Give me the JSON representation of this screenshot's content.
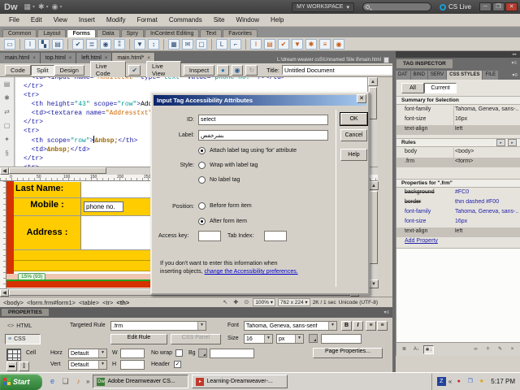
{
  "colors": {
    "form_yellow": "#FFCC00",
    "page_red": "#D63100",
    "dialog_title_start": "#0A246A",
    "dialog_title_end": "#A6CAF0",
    "link_blue": "#0000CC",
    "css_value_blue": "#2222AA"
  },
  "titlebar": {
    "logo": "Dw",
    "workspace_label": "MY WORKSPACE",
    "cs_live_label": "CS Live"
  },
  "menubar": {
    "items": [
      "File",
      "Edit",
      "View",
      "Insert",
      "Modify",
      "Format",
      "Commands",
      "Site",
      "Window",
      "Help"
    ]
  },
  "insert_bar": {
    "tabs": [
      "Common",
      "Layout",
      "Forms",
      "Data",
      "Spry",
      "InContext Editing",
      "Text",
      "Favorites"
    ],
    "active_tab": "Forms",
    "icons": [
      "form",
      "text-field",
      "hidden-field",
      "textarea",
      "checkbox",
      "checkbox-group",
      "radio-button",
      "radio-group",
      "select-list",
      "jump-menu",
      "image-field",
      "file-field",
      "button",
      "label",
      "fieldset",
      "spry-text-field",
      "spry-textarea",
      "spry-checkbox",
      "spry-select",
      "spry-password",
      "spry-confirm",
      "spry-radio-group"
    ]
  },
  "doc_tabs": {
    "tabs": [
      {
        "label": "main.html",
        "active": false
      },
      {
        "label": "top.html",
        "active": false
      },
      {
        "label": "left.html",
        "active": false
      },
      {
        "label": "main.html*",
        "active": true
      }
    ],
    "path": "L:\\dream weaver cs5\\Unnamed Site 8\\main.html"
  },
  "doc_toolbar": {
    "view_buttons": [
      "Code",
      "Split",
      "Design"
    ],
    "active_view": "Split",
    "live_code": "Live Code",
    "live_view": "Live View",
    "inspect": "Inspect",
    "title_label": "Title:",
    "title_value": "Untitled Document"
  },
  "code_view": {
    "lines": [
      {
        "seg": [
          {
            "t": "  <td><input name=",
            "c": "t"
          },
          {
            "t": "\"Mobiletxt\"",
            "c": "s"
          },
          {
            "t": " type=",
            "c": "t"
          },
          {
            "t": "\"text\"",
            "c": "v"
          },
          {
            "t": " value=",
            "c": "t"
          },
          {
            "t": "\"phone no.\"",
            "c": "v"
          },
          {
            "t": " /></td>",
            "c": "t"
          }
        ]
      },
      {
        "seg": [
          {
            "t": "</tr>",
            "c": "t"
          }
        ]
      },
      {
        "seg": [
          {
            "t": "<tr>",
            "c": "t"
          }
        ]
      },
      {
        "seg": [
          {
            "t": "  <th height=",
            "c": "t"
          },
          {
            "t": "\"43\"",
            "c": "v"
          },
          {
            "t": " scope=",
            "c": "t"
          },
          {
            "t": "\"row\"",
            "c": "v"
          },
          {
            "t": ">",
            "c": "t"
          },
          {
            "t": "Address :",
            "c": "x"
          },
          {
            "t": "</th>",
            "c": "t"
          }
        ]
      },
      {
        "seg": [
          {
            "t": "  <td><textarea name=",
            "c": "t"
          },
          {
            "t": "\"Addresstxt\"",
            "c": "s"
          },
          {
            "t": "></textarea></td>",
            "c": "t"
          }
        ]
      },
      {
        "seg": [
          {
            "t": "</tr>",
            "c": "t"
          }
        ]
      },
      {
        "seg": [
          {
            "t": "<tr>",
            "c": "t"
          }
        ]
      },
      {
        "seg": [
          {
            "t": "  <th scope=",
            "c": "t"
          },
          {
            "t": "\"row\"",
            "c": "v"
          },
          {
            "t": ">",
            "c": "t",
            "caretAfter": true
          },
          {
            "t": "&nbsp;",
            "c": "e"
          },
          {
            "t": "</th>",
            "c": "t"
          }
        ]
      },
      {
        "seg": [
          {
            "t": "  <td>",
            "c": "t"
          },
          {
            "t": "&nbsp;",
            "c": "e"
          },
          {
            "t": "</td>",
            "c": "t"
          }
        ]
      },
      {
        "seg": [
          {
            "t": "</tr>",
            "c": "t"
          }
        ]
      },
      {
        "seg": [
          {
            "t": "<tr>",
            "c": "t"
          }
        ]
      }
    ]
  },
  "design_view": {
    "ruler_numbers": [
      "0",
      "50",
      "100",
      "150",
      "200",
      "250"
    ],
    "form_rows": [
      {
        "label": "Last Name:",
        "type": "text"
      },
      {
        "label": "Mobile :",
        "type": "text",
        "value": "phone no."
      },
      {
        "label": "Address :",
        "type": "textarea"
      }
    ],
    "table_width_badge": "15% (93)"
  },
  "dialog": {
    "title": "Input Tag Accessibility Attributes",
    "id_label": "ID:",
    "id_value": "select",
    "label_label": "Label:",
    "label_value": "بشرخفض",
    "style_label": "Style:",
    "style_options": [
      {
        "label": "Attach label tag using 'for' attribute",
        "selected": true
      },
      {
        "label": "Wrap with label tag",
        "selected": false
      },
      {
        "label": "No label tag",
        "selected": false
      }
    ],
    "position_label": "Position:",
    "position_options": [
      {
        "label": "Before form item",
        "selected": false
      },
      {
        "label": "After form item",
        "selected": true
      }
    ],
    "access_key_label": "Access key:",
    "tab_index_label": "Tab Index:",
    "info_line1": "If you don't want to enter this information when",
    "info_line2": "inserting objects, ",
    "info_link": "change the Accessibility preferences.",
    "buttons": [
      "OK",
      "Cancel",
      "Help"
    ]
  },
  "status_bar": {
    "tags": [
      "<body>",
      "<form.frm#form1>",
      "<table>",
      "<tr>",
      "<th>"
    ],
    "zoom": "100%",
    "dimensions": "762 x 224",
    "size_time": "2K / 1 sec",
    "encoding": "Unicode (UTF-8)"
  },
  "properties_panel": {
    "tab": "PROPERTIES",
    "html_button": "HTML",
    "css_button": "CSS",
    "targeted_rule_label": "Targeted Rule",
    "targeted_rule_value": ".frm",
    "edit_rule": "Edit Rule",
    "css_panel": "CSS Panel",
    "font_label": "Font",
    "font_value": "Tahoma, Geneva, sans-serif",
    "size_label": "Size",
    "size_value": "16",
    "unit_value": "px",
    "cell_label": "Cell",
    "horz_label": "Horz",
    "horz_value": "Default",
    "vert_label": "Vert",
    "vert_value": "Default",
    "w_label": "W",
    "h_label": "H",
    "no_wrap_label": "No wrap",
    "header_label": "Header",
    "bg_label": "Bg",
    "page_properties": "Page Properties..."
  },
  "right_panel": {
    "tag_inspector_title": "TAG INSPECTOR",
    "tabs": [
      "DAT",
      "BIND",
      "SERV",
      "CSS STYLES",
      "FILE"
    ],
    "active_tab": "CSS STYLES",
    "all_button": "All",
    "current_button": "Current",
    "summary_title": "Summary for Selection",
    "summary_rows": [
      {
        "name": "font-family",
        "value": "Tahoma, Geneva, sans-...",
        "hl": false
      },
      {
        "name": "font-size",
        "value": "16px",
        "hl": false
      },
      {
        "name": "text-align",
        "value": "left",
        "hl": true
      }
    ],
    "rules_title": "Rules",
    "rules_rows": [
      {
        "name": "body",
        "value": "<body>",
        "hl": false
      },
      {
        "name": ".frm",
        "value": "<form>",
        "hl": true
      }
    ],
    "props_title": "Properties for \".frm\"",
    "props_rows": [
      {
        "name": "background",
        "value": "#FC0",
        "struck": true,
        "blue": false,
        "hl": false
      },
      {
        "name": "border",
        "value": "thin dashed #F00",
        "struck": true,
        "blue": false,
        "hl": false
      },
      {
        "name": "font-family",
        "value": "Tahoma, Geneva, sans-...",
        "struck": false,
        "blue": true,
        "hl": false
      },
      {
        "name": "font-size",
        "value": "16px",
        "struck": false,
        "blue": true,
        "hl": false
      },
      {
        "name": "text-align",
        "value": "left",
        "struck": false,
        "blue": false,
        "hl": true
      }
    ],
    "add_property": "Add Property"
  },
  "taskbar": {
    "start": "Start",
    "quick_launch": [
      "internet-explorer",
      "show-desktop",
      "media-player"
    ],
    "tasks": [
      {
        "label": "Adobe Dreamweaver CS...",
        "icon": "dreamweaver",
        "active": true
      },
      {
        "label": "Learning-Dreamweaver-...",
        "icon": "media-file",
        "active": false
      }
    ],
    "tray_collapse": "«",
    "tray_icons": [
      "tablet-utility",
      "messenger",
      "display-settings",
      "updates-star"
    ],
    "clock": "5:17 PM"
  }
}
